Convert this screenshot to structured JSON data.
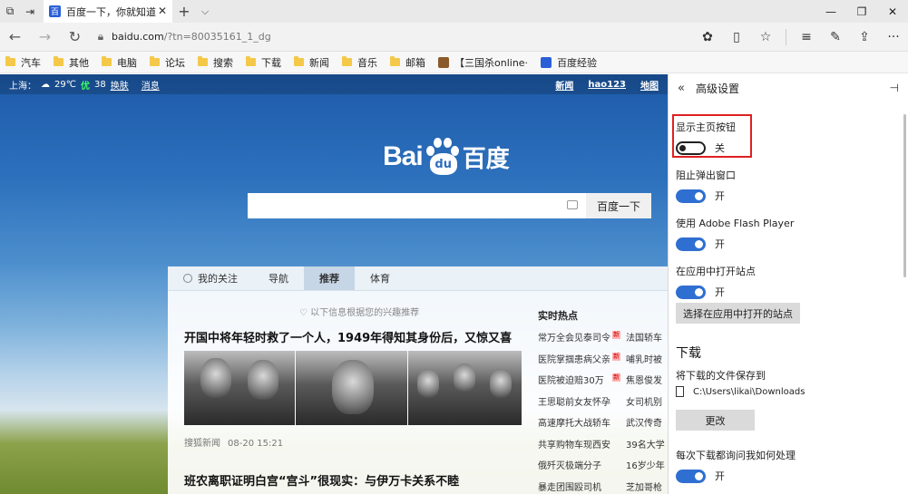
{
  "tab": {
    "favicon": "百",
    "title": "百度一下，你就知道"
  },
  "address": {
    "host": "baidu.com",
    "path": "/?tn=80035161_1_dg"
  },
  "favorites": [
    {
      "label": "汽车",
      "icon": "folder"
    },
    {
      "label": "其他",
      "icon": "folder"
    },
    {
      "label": "电脑",
      "icon": "folder"
    },
    {
      "label": "论坛",
      "icon": "folder"
    },
    {
      "label": "搜索",
      "icon": "folder"
    },
    {
      "label": "下载",
      "icon": "folder"
    },
    {
      "label": "新闻",
      "icon": "folder"
    },
    {
      "label": "音乐",
      "icon": "folder"
    },
    {
      "label": "邮箱",
      "icon": "folder"
    },
    {
      "label": "【三国杀online·",
      "icon": "site"
    },
    {
      "label": "百度经验",
      "icon": "baidu"
    }
  ],
  "top": {
    "city": "上海：",
    "temp": "29℃",
    "aqi_label": "优",
    "aqi": "38",
    "skin": "换肤",
    "msg": "消息",
    "links": [
      "新闻",
      "hao123",
      "地图"
    ]
  },
  "logo": {
    "latin": "Bai",
    "paw_text": "du",
    "cn": "百度"
  },
  "search": {
    "value": "",
    "button": "百度一下"
  },
  "feed": {
    "tabs": [
      "我的关注",
      "导航",
      "推荐",
      "体育"
    ],
    "active_tab": "推荐",
    "hint": "以下信息根据您的兴趣推荐",
    "headline": "开国中将年轻时救了一个人，1949年得知其身份后，又惊又喜",
    "source": "搜狐新闻",
    "time": "08-20 15:21",
    "headline2": "班农离职证明白宫“宫斗”很现实：与伊万卡关系不睦"
  },
  "hot": {
    "title": "实时热点",
    "items": [
      {
        "a": "常万全会见泰司令",
        "badge": "新",
        "b": "法国轿车"
      },
      {
        "a": "医院掌掴患病父亲",
        "badge": "新",
        "b": "哺乳时被"
      },
      {
        "a": "医院被迫赔30万",
        "badge": "新",
        "b": "焦恩俊发"
      },
      {
        "a": "王思聪前女友怀孕",
        "badge": "",
        "b": "女司机别"
      },
      {
        "a": "高速摩托大战轿车",
        "badge": "",
        "b": "武汉传奇"
      },
      {
        "a": "共享购物车现西安",
        "badge": "",
        "b": "39名大学"
      },
      {
        "a": "俄歼灭极端分子",
        "badge": "",
        "b": "16岁少年"
      },
      {
        "a": "暴走团围殴司机",
        "badge": "",
        "b": "芝加哥枪"
      }
    ]
  },
  "settings": {
    "title": "高级设置",
    "home_button": {
      "label": "显示主页按钮",
      "state": "关",
      "on": false
    },
    "popup": {
      "label": "阻止弹出窗口",
      "state": "开",
      "on": true
    },
    "flash": {
      "label": "使用 Adobe Flash Player",
      "state": "开",
      "on": true
    },
    "open_in_app": {
      "label": "在应用中打开站点",
      "state": "开",
      "on": true
    },
    "choose_sites_button": "选择在应用中打开的站点",
    "download_section": "下载",
    "save_to_label": "将下载的文件保存到",
    "save_path": "C:\\Users\\likai\\Downloads",
    "change_button": "更改",
    "ask_download": {
      "label": "每次下载都询问我如何处理",
      "state": "开",
      "on": true
    }
  },
  "colors": {
    "accent": "#2f6fd1",
    "highlight": "#e02020"
  }
}
